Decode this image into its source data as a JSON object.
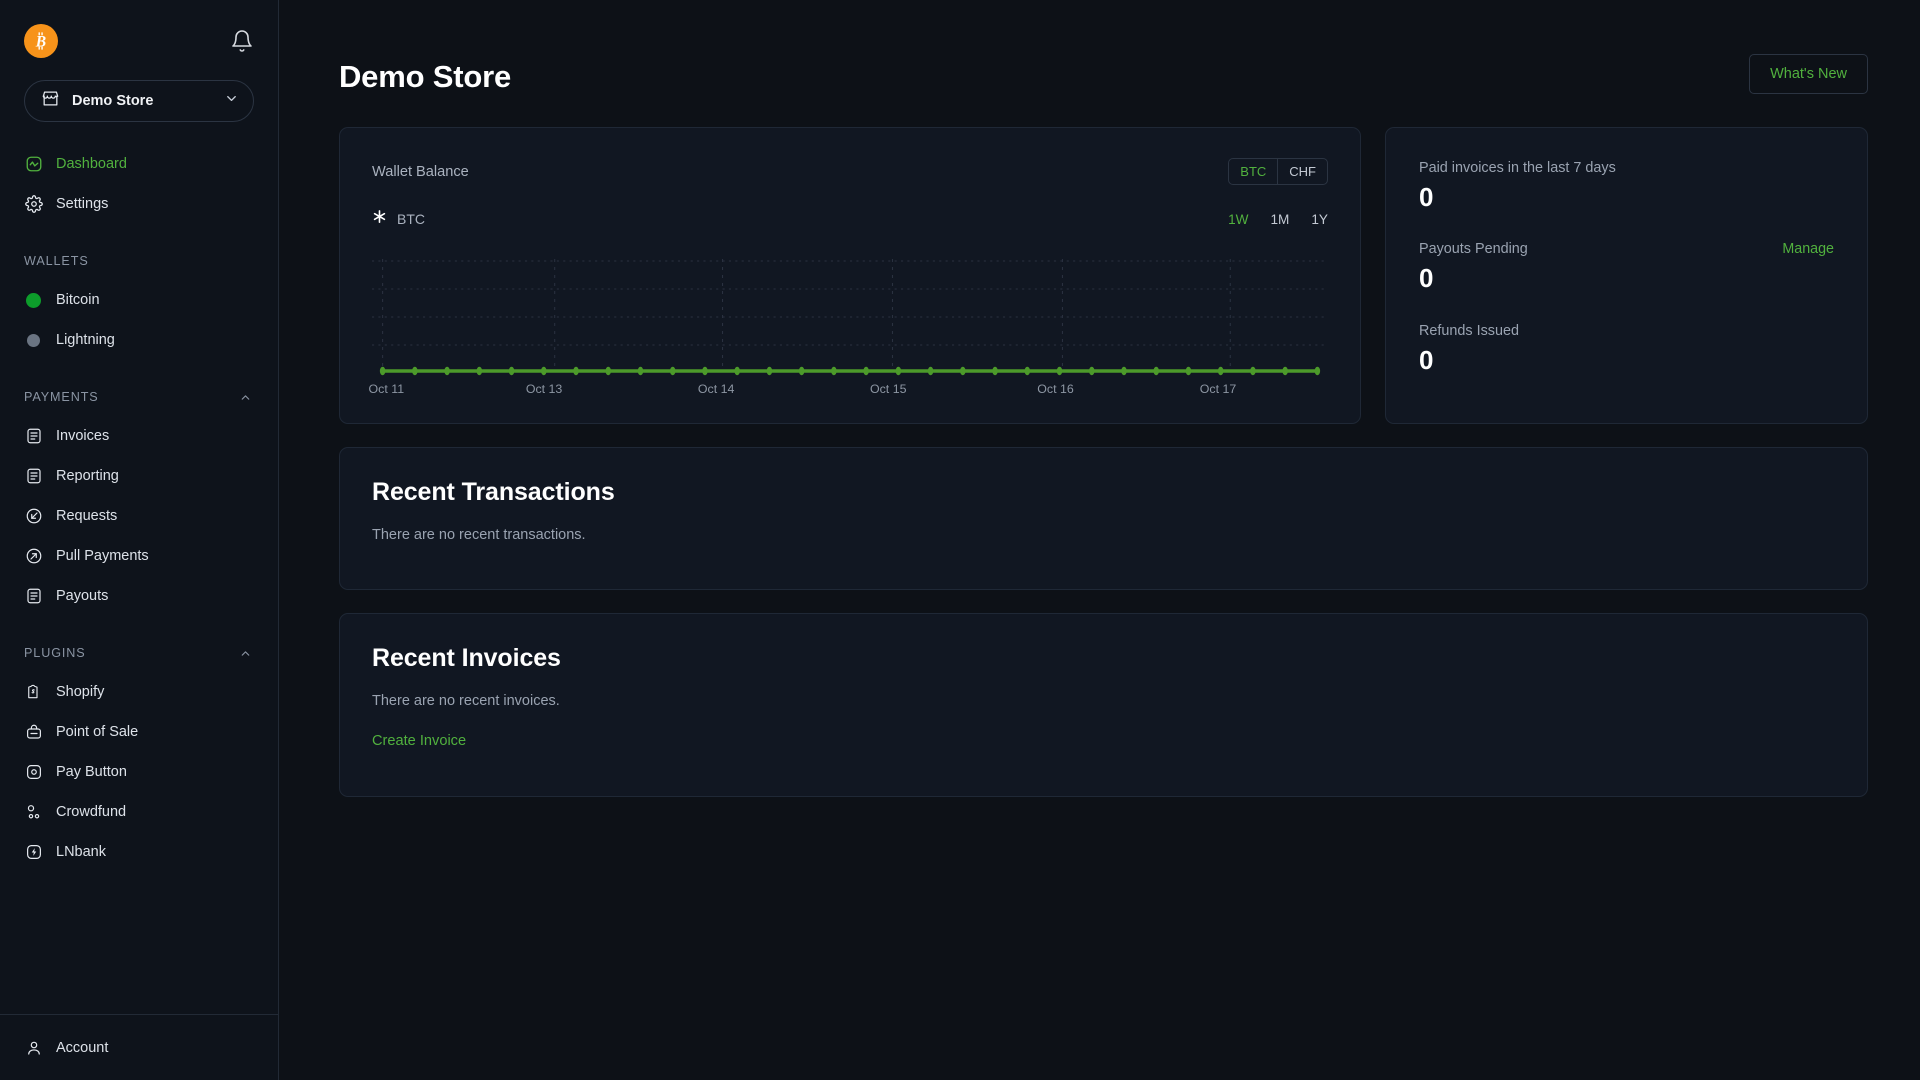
{
  "brand": {
    "logo_icon": "bitcoin-logo",
    "notifications_icon": "bell-icon"
  },
  "store_switcher": {
    "icon": "store-icon",
    "label": "Demo Store",
    "chevron": "chevron-down-icon"
  },
  "sidebar": {
    "nav": [
      {
        "label": "Dashboard",
        "icon": "dashboard-pulse-icon",
        "active": true
      },
      {
        "label": "Settings",
        "icon": "gear-icon",
        "active": false
      }
    ],
    "sections": [
      {
        "title": "WALLETS",
        "collapsible": false,
        "items": [
          {
            "label": "Bitcoin",
            "icon": "status-dot-online",
            "status": "online"
          },
          {
            "label": "Lightning",
            "icon": "status-dot-offline",
            "status": "offline"
          }
        ]
      },
      {
        "title": "PAYMENTS",
        "collapsible": true,
        "chevron": "chevron-up-icon",
        "items": [
          {
            "label": "Invoices",
            "icon": "invoice-icon"
          },
          {
            "label": "Reporting",
            "icon": "report-icon"
          },
          {
            "label": "Requests",
            "icon": "arrow-in-circle-icon"
          },
          {
            "label": "Pull Payments",
            "icon": "arrow-out-circle-icon"
          },
          {
            "label": "Payouts",
            "icon": "payout-icon"
          }
        ]
      },
      {
        "title": "PLUGINS",
        "collapsible": true,
        "chevron": "chevron-up-icon",
        "items": [
          {
            "label": "Shopify",
            "icon": "shopify-bag-icon"
          },
          {
            "label": "Point of Sale",
            "icon": "pos-bag-icon"
          },
          {
            "label": "Pay Button",
            "icon": "pay-button-icon"
          },
          {
            "label": "Crowdfund",
            "icon": "crowdfund-icon"
          },
          {
            "label": "LNbank",
            "icon": "lightning-circle-icon"
          }
        ]
      }
    ],
    "account": {
      "label": "Account",
      "icon": "user-icon"
    }
  },
  "header": {
    "title": "Demo Store",
    "whats_new": "What's New"
  },
  "balance_card": {
    "title": "Wallet Balance",
    "currencies": [
      {
        "code": "BTC",
        "selected": true
      },
      {
        "code": "CHF",
        "selected": false
      }
    ],
    "series_icon": "snowflake-icon",
    "series_label": "BTC",
    "ranges": [
      {
        "label": "1W",
        "selected": true
      },
      {
        "label": "1M",
        "selected": false
      },
      {
        "label": "1Y",
        "selected": false
      }
    ]
  },
  "stats": [
    {
      "label": "Paid invoices in the last 7 days",
      "value": "0",
      "action": null
    },
    {
      "label": "Payouts Pending",
      "value": "0",
      "action": "Manage"
    },
    {
      "label": "Refunds Issued",
      "value": "0",
      "action": null
    }
  ],
  "recent_transactions": {
    "title": "Recent Transactions",
    "empty": "There are no recent transactions."
  },
  "recent_invoices": {
    "title": "Recent Invoices",
    "empty": "There are no recent invoices.",
    "create": "Create Invoice"
  },
  "colors": {
    "accent_green": "#51b13e",
    "line_green": "#4c9a2a",
    "bitcoin_orange": "#f7931a",
    "page_bg": "#0d1117",
    "sidebar_bg": "#0e131b",
    "card_bg": "#111722",
    "border": "#1f2836",
    "muted_text": "#9aa3b1"
  },
  "chart_data": {
    "type": "line",
    "title": "Wallet Balance",
    "ylabel": "BTC",
    "xlabel": "",
    "grid": true,
    "legend": [
      "BTC"
    ],
    "legend_position": "top-left",
    "range_selected": "1W",
    "tick_labels": [
      "Oct 11",
      "Oct 13",
      "Oct 14",
      "Oct 15",
      "Oct 16",
      "Oct 17"
    ],
    "tick_positions_pct": [
      1.5,
      18.0,
      36.0,
      54.0,
      71.5,
      88.5
    ],
    "series": [
      {
        "name": "BTC",
        "color": "#4c9a2a",
        "values": [
          0,
          0,
          0,
          0,
          0,
          0,
          0,
          0,
          0,
          0,
          0,
          0,
          0,
          0,
          0,
          0,
          0,
          0,
          0,
          0,
          0,
          0,
          0,
          0,
          0,
          0,
          0,
          0,
          0,
          0
        ]
      }
    ],
    "ylim": [
      0,
      1
    ],
    "point_count": 30,
    "all_values_zero": true
  }
}
